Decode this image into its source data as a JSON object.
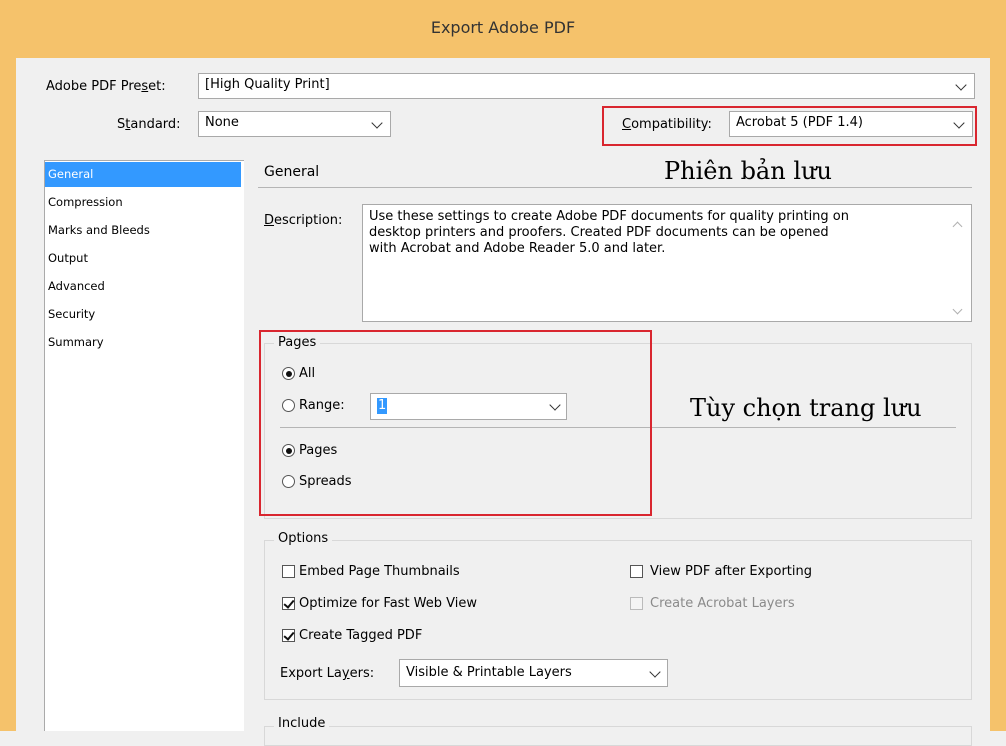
{
  "window": {
    "title": "Export Adobe PDF"
  },
  "preset": {
    "label": "Adobe PDF Preset:",
    "value": "[High Quality Print]"
  },
  "standard": {
    "label": "Standard:",
    "value": "None"
  },
  "compatibility": {
    "label": "Compatibility:",
    "value": "Acrobat 5 (PDF 1.4)"
  },
  "sidebar": {
    "items": [
      "General",
      "Compression",
      "Marks and Bleeds",
      "Output",
      "Advanced",
      "Security",
      "Summary"
    ]
  },
  "section": {
    "title": "General"
  },
  "description": {
    "label": "Description:",
    "line1": "Use these settings to create Adobe PDF documents for quality printing on",
    "line2": "desktop printers and proofers.  Created PDF documents can be opened",
    "line3": "with Acrobat and Adobe Reader 5.0 and later."
  },
  "pages": {
    "title": "Pages",
    "all": "All",
    "range_label": "Range:",
    "range_value": "1",
    "pages_opt": "Pages",
    "spreads_opt": "Spreads"
  },
  "options": {
    "title": "Options",
    "embed_thumbnails": "Embed Page Thumbnails",
    "optimize_web": "Optimize for Fast Web View",
    "tagged_pdf": "Create Tagged PDF",
    "view_after": "View PDF after Exporting",
    "acrobat_layers": "Create Acrobat Layers",
    "export_layers_label": "Export Layers:",
    "export_layers_value": "Visible & Printable Layers"
  },
  "include": {
    "title": "Include"
  },
  "annotations": {
    "version": "Phiên bản lưu",
    "pages": "Tùy chọn trang lưu"
  },
  "colors": {
    "accent": "#3399ff",
    "titlebar": "#f5c26b",
    "annotation_box": "#d9262f"
  }
}
